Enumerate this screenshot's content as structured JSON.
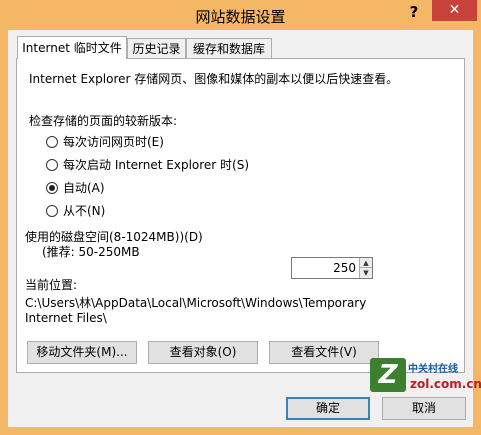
{
  "window": {
    "title": "网站数据设置",
    "help_label": "?",
    "close_label": "✕"
  },
  "tabs": [
    {
      "label": "Internet 临时文件",
      "active": true
    },
    {
      "label": "历史记录",
      "active": false
    },
    {
      "label": "缓存和数据库",
      "active": false
    }
  ],
  "temp_files": {
    "description": "Internet Explorer 存储网页、图像和媒体的副本以便以后快速查看。",
    "check_heading": "检查存储的页面的较新版本:",
    "options": [
      {
        "label": "每次访问网页时(E)",
        "selected": false
      },
      {
        "label": "每次启动 Internet Explorer 时(S)",
        "selected": false
      },
      {
        "label": "自动(A)",
        "selected": true
      },
      {
        "label": "从不(N)",
        "selected": false
      }
    ],
    "disk_space_label": "使用的磁盘空间(8-1024MB))(D)",
    "disk_space_hint": "(推荐: 50-250MB",
    "disk_space_value": "250",
    "location_heading": "当前位置:",
    "location_line1": "C:\\Users\\林\\AppData\\Local\\Microsoft\\Windows\\Temporary",
    "location_line2": "Internet Files\\",
    "buttons": {
      "move_folder": "移动文件夹(M)...",
      "view_objects": "查看对象(O)",
      "view_files": "查看文件(V)"
    }
  },
  "footer": {
    "ok_label": "确定",
    "cancel_label": "取消"
  },
  "watermark": {
    "logo_letter": "Z",
    "top_text": "中关村在线",
    "bottom_text": "zol.com.cn"
  }
}
